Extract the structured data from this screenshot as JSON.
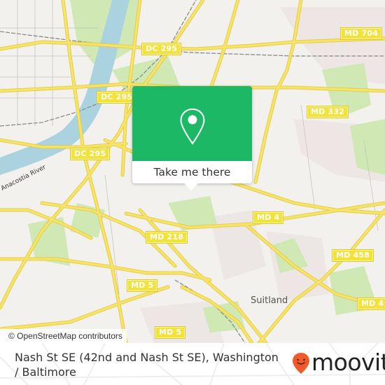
{
  "map": {
    "shields": [
      {
        "label": "DC 295",
        "id": "dc295-top"
      },
      {
        "label": "DC 295",
        "id": "dc295-mid"
      },
      {
        "label": "DC 295",
        "id": "dc295-left"
      },
      {
        "label": "MD 704",
        "id": "md704"
      },
      {
        "label": "MD 332",
        "id": "md332"
      },
      {
        "label": "MD 4",
        "id": "md4-upper"
      },
      {
        "label": "MD 218",
        "id": "md218"
      },
      {
        "label": "MD 458",
        "id": "md458"
      },
      {
        "label": "MD 5",
        "id": "md5-upper"
      },
      {
        "label": "MD 4",
        "id": "md4-lower"
      },
      {
        "label": "MD 5",
        "id": "md5-lower"
      }
    ],
    "places": {
      "suitland": "Suitland",
      "river": "Anacostia River"
    },
    "attribution": "© OpenStreetMap contributors",
    "colors": {
      "land": "#f2f1ed",
      "park": "#cfe8b4",
      "water": "#aad3df",
      "road": "#f7e36b",
      "road_casing": "#e3cc3c",
      "rail": "#8a8a8a"
    }
  },
  "popup": {
    "icon": "map-pin-icon",
    "cta_label": "Take me there",
    "accent": "#1cb866"
  },
  "footer": {
    "title": "Nash St SE (42nd and Nash St SE), Washington / Baltimore",
    "brand": {
      "name": "moovit",
      "icon": "moovit-pin-logo-icon",
      "accent": "#f05a28"
    }
  }
}
